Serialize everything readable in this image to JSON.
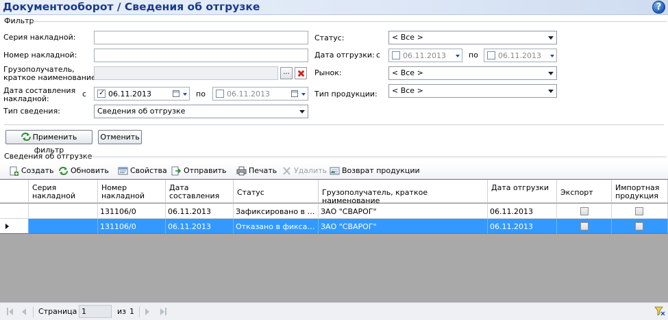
{
  "window": {
    "title": "Документооборот  / Сведения об отгрузке"
  },
  "filter": {
    "group_label": "Фильтр",
    "series_label": "Серия накладной:",
    "series_value": "",
    "number_label": "Номер накладной:",
    "number_value": "",
    "consignee_label_1": "Грузополучатель,",
    "consignee_label_2": "краткое наименование:",
    "consignee_value": "",
    "consignee_browse": "...",
    "doc_date_label_1": "Дата составления",
    "doc_date_label_2": "накладной:",
    "doc_date_from_prefix": "с",
    "doc_date_from": "06.11.2013",
    "doc_date_to_prefix": "по",
    "doc_date_to": "06.11.2013",
    "info_type_label": "Тип сведения:",
    "info_type_value": "Сведения об отгрузке",
    "status_label": "Статус:",
    "status_value": "< Все >",
    "ship_date_label": "Дата отгрузки:",
    "ship_date_from_prefix": "с",
    "ship_date_from": "06.11.2013",
    "ship_date_to_prefix": "по",
    "ship_date_to": "06.11.2013",
    "market_label": "Рынок:",
    "market_value": "< Все >",
    "product_type_label": "Тип продукции:",
    "product_type_value": "< Все >",
    "apply_label": "Применить фильтр",
    "cancel_label": "Отменить"
  },
  "section": {
    "label": "Сведения об отгрузке"
  },
  "toolbar": {
    "create": "Создать",
    "refresh": "Обновить",
    "properties": "Свойства",
    "send": "Отправить",
    "print": "Печать",
    "delete": "Удалить",
    "return": "Возврат продукции"
  },
  "grid": {
    "headers": {
      "series": "Серия накладной",
      "number": "Номер накладной",
      "doc_date": "Дата составления",
      "status": "Статус",
      "consignee": "Грузополучатель, краткое наименование",
      "ship_date": "Дата отгрузки",
      "export": "Экспорт",
      "import": "Импортная продукция"
    },
    "rows": [
      {
        "series": "",
        "number": "131106/0",
        "doc_date": "06.11.2013",
        "status": "Зафиксировано в ЕГАИС",
        "consignee": "ЗАО \"СВАРОГ\"",
        "ship_date": "06.11.2013",
        "export": false,
        "import": false
      },
      {
        "series": "",
        "number": "131106/0",
        "doc_date": "06.11.2013",
        "status": "Отказано в фиксации",
        "consignee": "ЗАО \"СВАРОГ\"",
        "ship_date": "06.11.2013",
        "export": false,
        "import": false
      }
    ]
  },
  "pager": {
    "page_label": "Страница",
    "page_value": "1",
    "of_label": "из",
    "total_pages": "1"
  },
  "colors": {
    "title": "#1a3a8c",
    "selection": "#3399ff",
    "grid_empty": "#a9a9a9"
  }
}
